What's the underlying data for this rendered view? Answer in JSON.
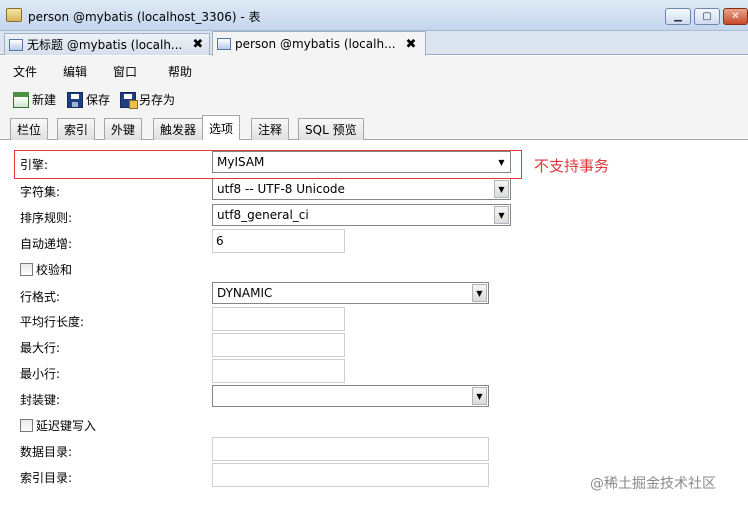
{
  "window": {
    "title": "person @mybatis (localhost_3306) - 表",
    "controls": [
      "minimize",
      "maximize",
      "close"
    ]
  },
  "doc_tabs": [
    {
      "label": "无标题 @mybatis (localh...",
      "close": "✖",
      "active": false
    },
    {
      "label": "person @mybatis (localh...",
      "close": "✖",
      "active": true
    }
  ],
  "menu": [
    "文件",
    "编辑",
    "窗口",
    "帮助"
  ],
  "toolbar": {
    "new": "新建",
    "save": "保存",
    "save_as": "另存为"
  },
  "tabs": [
    "栏位",
    "索引",
    "外键",
    "触发器",
    "选项",
    "注释",
    "SQL 预览"
  ],
  "active_tab": "选项",
  "form": {
    "engine": {
      "label": "引擎:",
      "value": "MyISAM"
    },
    "charset": {
      "label": "字符集:",
      "value": "utf8 -- UTF-8 Unicode"
    },
    "collation": {
      "label": "排序规则:",
      "value": "utf8_general_ci"
    },
    "auto_increment": {
      "label": "自动递增:",
      "value": "6"
    },
    "checksum": {
      "label": "校验和",
      "checked": false
    },
    "row_format": {
      "label": "行格式:",
      "value": "DYNAMIC"
    },
    "avg_row_length": {
      "label": "平均行长度:",
      "value": ""
    },
    "max_rows": {
      "label": "最大行:",
      "value": ""
    },
    "min_rows": {
      "label": "最小行:",
      "value": ""
    },
    "pack_keys": {
      "label": "封装键:",
      "value": ""
    },
    "delay_key_write": {
      "label": "延迟键写入",
      "checked": false
    },
    "data_directory": {
      "label": "数据目录:",
      "value": ""
    },
    "index_directory": {
      "label": "索引目录:",
      "value": ""
    }
  },
  "annotation": "不支持事务",
  "watermark": "@稀土掘金技术社区",
  "colors": {
    "annotation": "#e0393a",
    "titlebar": "#c4d6ec"
  }
}
